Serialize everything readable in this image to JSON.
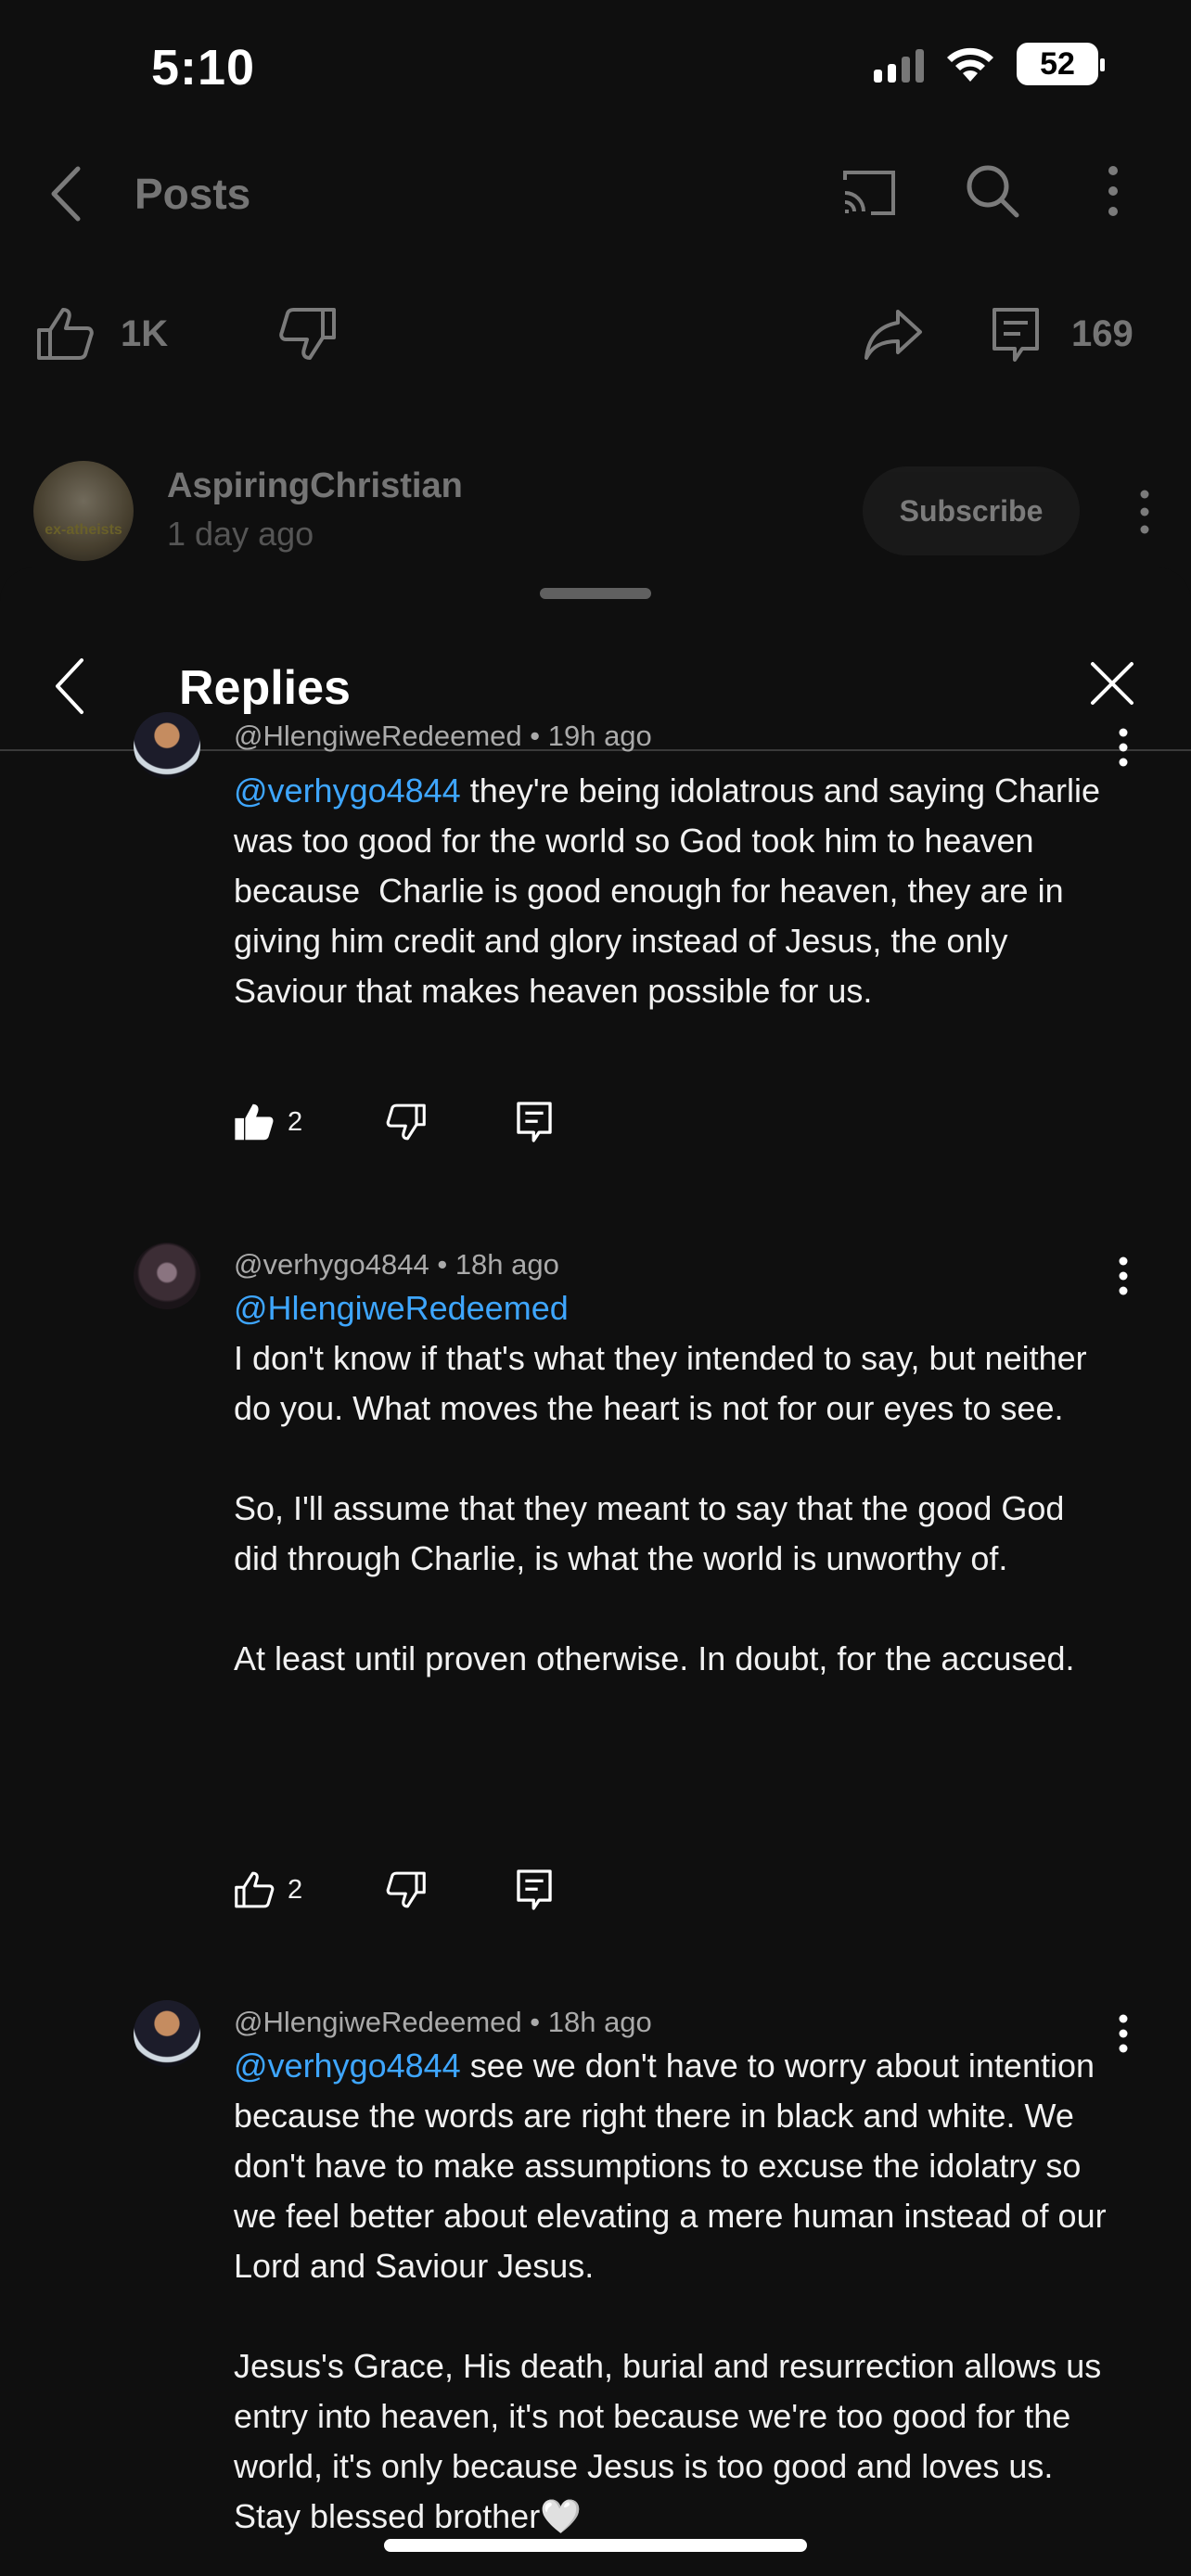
{
  "status_bar": {
    "time": "5:10",
    "battery": "52"
  },
  "header": {
    "title": "Posts"
  },
  "post_actions": {
    "like_count": "1K",
    "comment_count": "169"
  },
  "channel": {
    "name": "AspiringChristian",
    "posted": "1 day ago",
    "avatar_text": "ex-atheists",
    "subscribe_label": "Subscribe"
  },
  "sheet": {
    "title": "Replies"
  },
  "replies": [
    {
      "author": "@HlengiweRedeemed",
      "time": "19h ago",
      "mention": "@verhygo4844",
      "text": " they're being idolatrous and saying Charlie was too good for the world so God took him to heaven because  Charlie is good enough for heaven, they are in giving him credit and glory instead of Jesus, the only Saviour that makes heaven possible for us.",
      "likes": "2",
      "liked": true
    },
    {
      "author": "@verhygo4844",
      "time": "18h ago",
      "mention": "@HlengiweRedeemed",
      "text": "I don't know if that's what they intended to say, but neither do you. What moves the heart is not for our eyes to see.\n\nSo, I'll assume that they meant to say that the good God did through Charlie, is what the world is unworthy of.\n\nAt least until proven otherwise. In doubt, for the accused.",
      "likes": "2",
      "liked": false
    },
    {
      "author": "@HlengiweRedeemed",
      "time": "18h ago",
      "mention": "@verhygo4844",
      "text": " see we don't have to worry about intention because the words are right there in black and white. We don't have to make assumptions to excuse the idolatry so we feel better about elevating a mere human instead of our Lord and Saviour Jesus.\n\nJesus's Grace, His death, burial and resurrection allows us entry into heaven, it's not because we're too good for the world, it's only because Jesus is too good and loves us. Stay blessed brother🤍",
      "likes": "",
      "liked": false
    }
  ]
}
